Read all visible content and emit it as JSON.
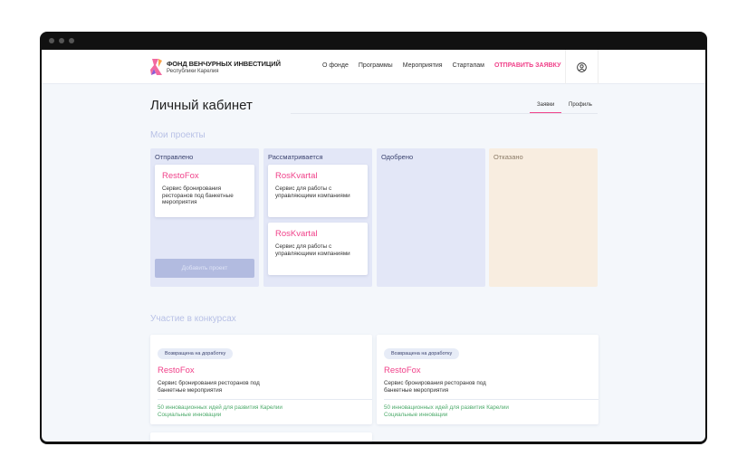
{
  "header": {
    "brand_title": "ФОНД ВЕНЧУРНЫХ ИНВЕСТИЦИЙ",
    "brand_subtitle": "Республики Карелия",
    "nav": [
      "О фонде",
      "Программы",
      "Мероприятия",
      "Стартапам"
    ],
    "cta": "ОТПРАВИТЬ ЗАЯВКУ"
  },
  "page": {
    "title": "Личный кабинет",
    "tabs": [
      "Заявки",
      "Профиль"
    ]
  },
  "projects": {
    "title": "Мои проекты",
    "columns": [
      {
        "title": "Отправлено",
        "cards": [
          {
            "name": "RestoFox",
            "desc": "Сервис бронирования ресторанов под банкетные мероприятия"
          }
        ],
        "button": "Добавить проект"
      },
      {
        "title": "Рассматривается",
        "cards": [
          {
            "name": "RosKvartal",
            "desc": "Сервис для работы с управляющими компаниями"
          },
          {
            "name": "RosKvartal",
            "desc": "Сервис для работы с управляющими компаниями"
          }
        ]
      },
      {
        "title": "Одобрено"
      },
      {
        "title": "Отказано"
      }
    ]
  },
  "contests": {
    "title": "Участие в конкурсах",
    "cards": [
      {
        "status": "Возвращена на доработку",
        "name": "RestoFox",
        "desc": "Сервис бронирования ресторанов под банкетные мероприятия",
        "contest": "50 инновационных идей для развития Карелии",
        "category": "Социальные инновации"
      },
      {
        "status": "Возвращена на доработку",
        "name": "RestoFox",
        "desc": "Сервис бронирования ресторанов под банкетные мероприятия",
        "contest": "50 инновационных идей для развития Карелии",
        "category": "Социальные инновации"
      }
    ]
  }
}
